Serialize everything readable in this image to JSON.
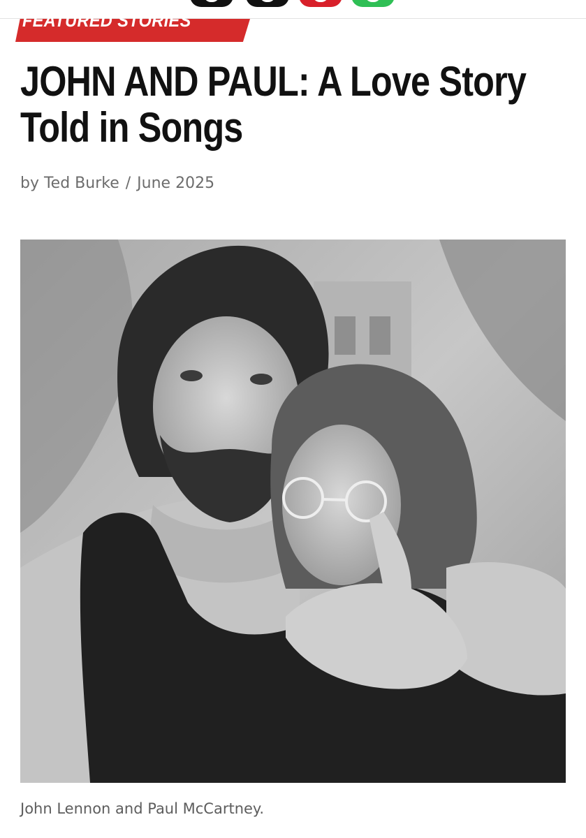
{
  "share": {
    "buttons": [
      {
        "icon": "x-twitter-icon",
        "color": "#111111"
      },
      {
        "icon": "threads-icon",
        "color": "#111111"
      },
      {
        "icon": "pinterest-icon",
        "color": "#d8202a"
      },
      {
        "icon": "whatsapp-icon",
        "color": "#2fbf55"
      }
    ]
  },
  "article": {
    "category": "FEATURED STORIES",
    "category_color": "#d52b2b",
    "title_line1": "JOHN AND PAUL: A Love Story",
    "title_line2": "Told in Songs",
    "author": "by Ted Burke",
    "separator": "/",
    "date": "June 2025",
    "image_caption": "John Lennon and Paul McCartney."
  }
}
